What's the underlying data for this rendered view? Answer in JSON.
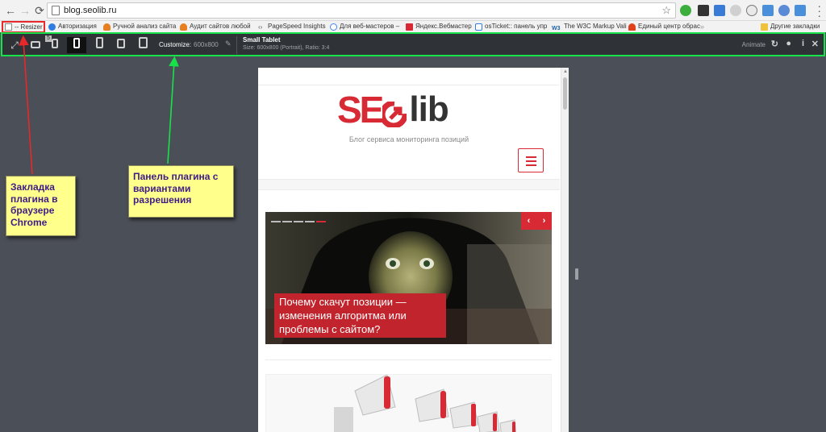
{
  "browser": {
    "url": "blog.seolib.ru",
    "bookmarks": [
      {
        "label": "-- Resizer",
        "color": "#ffffff"
      },
      {
        "label": "Авторизация",
        "color": "#2f7de1"
      },
      {
        "label": "Ручной анализ сайта",
        "color": "#e67e22"
      },
      {
        "label": "Аудит сайтов любой",
        "color": "#e67e22"
      },
      {
        "label": "PageSpeed Insights",
        "color": "#555555"
      },
      {
        "label": "Для веб-мастеров –",
        "color": "#4285f4"
      },
      {
        "label": "Яндекс.Вебмастер",
        "color": "#d72a35"
      },
      {
        "label": "osTicket:: панель упр",
        "color": "#2f7de1"
      },
      {
        "label": "The W3C Markup Vali",
        "color": "#1d5fa8"
      },
      {
        "label": "Единый центр обрас",
        "color": "#e0401c"
      }
    ],
    "other_bookmarks": "Другие закладки"
  },
  "plugin": {
    "tab_badge": "5",
    "customize_label": "Customize:",
    "customize_value": "600x800",
    "preset_title": "Small Tablet",
    "preset_info": "Size: 600x800 (Portrait), Ratio: 3:4",
    "animate_label": "Animate",
    "info_icon_glyph": "i",
    "close_icon_glyph": "✕"
  },
  "annotations": {
    "bookmark_note": "Закладка плагина в браузере Chrome",
    "panel_note": "Панель плагина с вариантами разрешения",
    "bookmark_arrow_color": "#e8282a",
    "panel_arrow_color": "#18e24a"
  },
  "site": {
    "logo_left": "SE",
    "logo_right": "lib",
    "tagline": "Блог сервиса мониторинга позиций",
    "slide_caption": "Почему скачут позиции — изменения алгоритма или проблемы с сайтом?",
    "slider_prev": "‹",
    "slider_next": "›",
    "brand_color": "#d72a35"
  }
}
